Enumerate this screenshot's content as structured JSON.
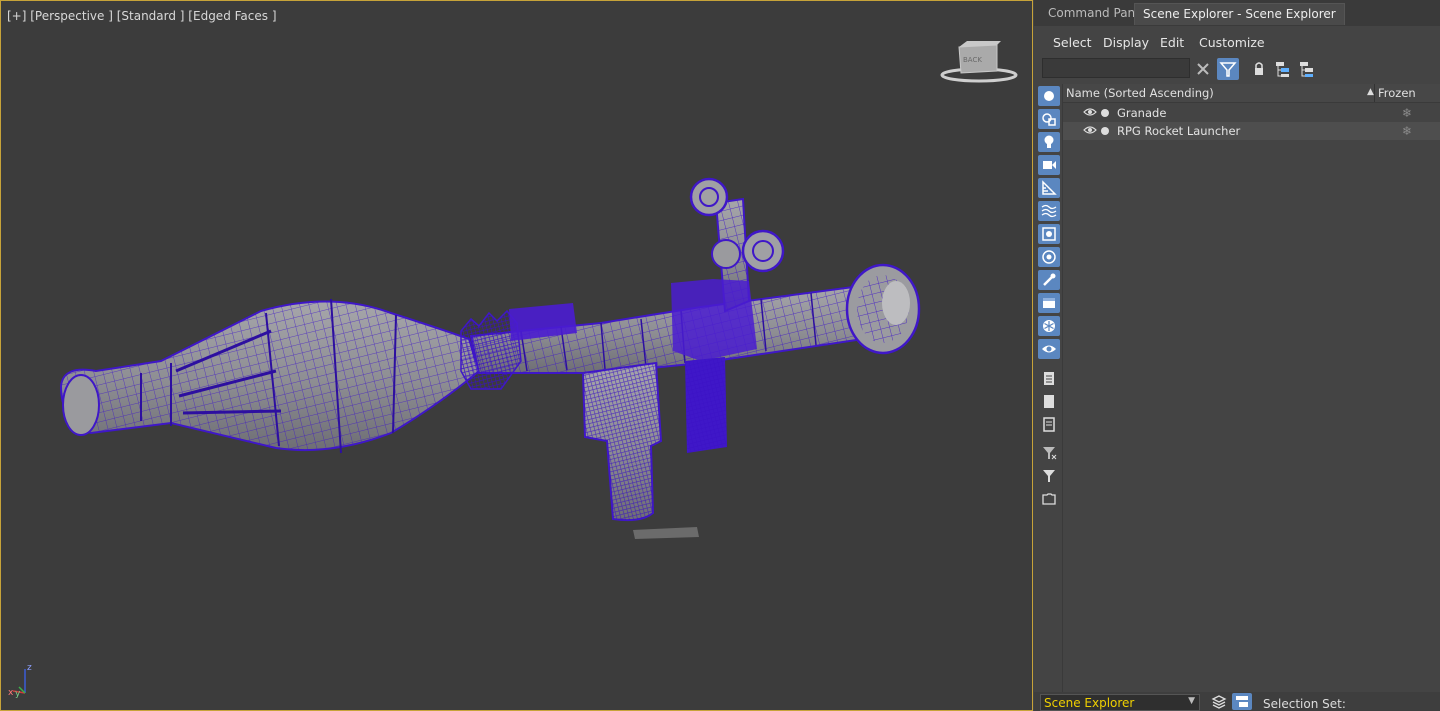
{
  "viewport": {
    "label": "[+] [Perspective ] [Standard ] [Edged Faces ]",
    "viewcube_text": "BACK",
    "axis_labels": {
      "z": "z",
      "x": "x",
      "y": "y"
    }
  },
  "panel": {
    "tabs": [
      {
        "label": "Command Panel",
        "active": false
      },
      {
        "label": "Scene Explorer - Scene Explorer",
        "active": true
      }
    ],
    "menu": [
      "Select",
      "Display",
      "Edit",
      "Customize"
    ],
    "search": {
      "value": "",
      "placeholder": ""
    },
    "toolbar_icons": [
      "clear-search-icon",
      "filter-toggle-icon",
      "lock-icon",
      "hierarchy-expand-icon",
      "hierarchy-collapse-icon"
    ],
    "left_toolbar_icons": [
      "geometry-filter-icon",
      "shapes-filter-icon",
      "lights-filter-icon",
      "cameras-filter-icon",
      "helpers-filter-icon",
      "spacewarps-filter-icon",
      "groups-filter-icon",
      "xrefs-filter-icon",
      "bones-filter-icon",
      "containers-filter-icon",
      "frozen-filter-icon",
      "hidden-filter-icon",
      "select-all-icon",
      "select-none-icon",
      "select-invert-icon",
      "filter-remove-icon",
      "filter-icon",
      "folder-icon"
    ],
    "list": {
      "columns": {
        "name": "Name (Sorted Ascending)",
        "frozen": "Frozen",
        "sort": "▲"
      },
      "rows": [
        {
          "name": "Granade",
          "frozen_icon": "❄",
          "selected": false
        },
        {
          "name": "RPG Rocket Launcher",
          "frozen_icon": "❄",
          "selected": true
        }
      ]
    },
    "bottom": {
      "explorer_select": "Scene Explorer",
      "selection_set_label": "Selection Set:"
    }
  },
  "colors": {
    "viewport_bg": "#3c3c3c",
    "active_border": "#c7a339",
    "wire_color": "#3f17c8",
    "mesh_gray": "#8e8e92",
    "accent_blue": "#5b87c0",
    "selected_text_yellow": "#f0d000"
  }
}
